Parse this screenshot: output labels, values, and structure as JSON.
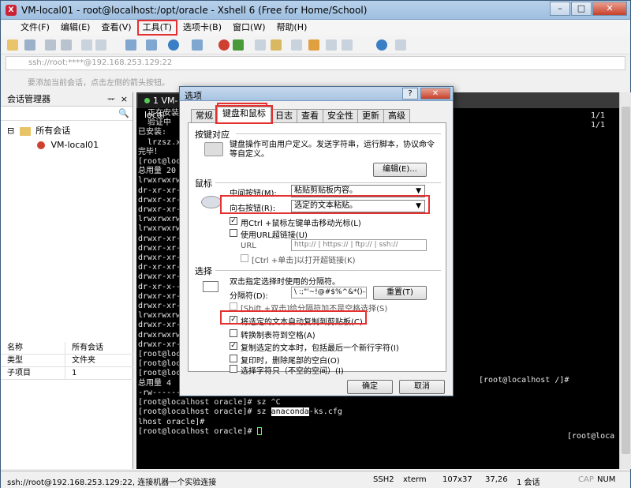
{
  "window": {
    "title": "VM-local01 - root@localhost:/opt/oracle - Xshell 6 (Free for Home/School)",
    "app_icon": "xshell-icon",
    "btn_min": "–",
    "btn_max": "□",
    "btn_close": "✕"
  },
  "menubar": {
    "items": [
      "文件(F)",
      "编辑(E)",
      "查看(V)",
      "工具(T)",
      "选项卡(B)",
      "窗口(W)",
      "帮助(H)"
    ]
  },
  "address": {
    "value": "ssh://root:****@192.168.253.129:22"
  },
  "hint": {
    "text": "要添加当前会话，点击左侧的箭头按钮。"
  },
  "session_manager": {
    "title": "会话管理器",
    "pin": "ᅲ",
    "close": "×",
    "search_icon": "🔍",
    "tree": {
      "root": "所有会话",
      "child": "VM-local01",
      "expander": "⊟"
    },
    "properties": [
      {
        "k": "名称",
        "v": "所有会话"
      },
      {
        "k": "类型",
        "v": "文件夹"
      },
      {
        "k": "子项目",
        "v": "1"
      }
    ]
  },
  "terminal": {
    "tab_label": "1 VM-local",
    "lines": [
      "  正在安装",
      "  验证中",
      "",
      "已安装:",
      "  lrzsz.x",
      "",
      "完毕！",
      "[root@local",
      "总用量 20",
      "lrwxrwxrwx",
      "dr-xr-xr-",
      "drwxr-xr-",
      "drwxr-xr-",
      "lrwxrwxrwx",
      "lrwxrwxrwx",
      "drwxr-xr-",
      "drwxr-xr-",
      "drwxr-xr-",
      "dr-xr-xr-",
      "drwxr-xr-",
      "dr-xr-x---",
      "drwxr-xr-",
      "drwxr-xr-",
      "lrwxrwxrwx",
      "drwxr-xr-",
      "drwxrwxrw",
      "drwxr-xr-",
      "[root@local",
      "[root@local",
      "[root@local",
      "总用量 4",
      "-rw-------. 1 root root 1413 4月   15 20:31 anaconda-ks.cfg",
      "[root@localhost oracle]# sz ^C",
      "[root@localhost oracle]# sz anaconda-ks.cfg",
      "lhost oracle]#",
      "[root@localhost oracle]# "
    ],
    "sel_word": "anaconda",
    "right_1": "1/1",
    "right_2": "1/1",
    "right_prompt": "[root@localhost /]#",
    "right_prompt2": "[root@loca"
  },
  "statusbar": {
    "connection": "ssh://root@192.168.253.129:22, 连接机器一个实验连接",
    "protocol": "SSH2",
    "term": "xterm",
    "size": "107x37",
    "pos": "37,26",
    "sessions": "1 会话",
    "caps": "CAP",
    "num": "NUM"
  },
  "dialog": {
    "title": "选项",
    "help": "?",
    "close": "✕",
    "tabs": [
      "常规",
      "键盘和鼠标",
      "日志",
      "查看",
      "安全性",
      "更新",
      "高级"
    ],
    "keyboard": {
      "section": "按键对应",
      "desc": "键盘操作可由用户定义。发送字符串，运行脚本，协议命令等自定义。",
      "edit_btn": "编辑(E)..."
    },
    "mouse": {
      "section": "鼠标",
      "middle_label": "中间按钮(M):",
      "middle_value": "粘贴剪贴板内容。",
      "right_label": "向右按钮(R):",
      "right_value": "选定的文本粘贴。",
      "ctrl_click": "用Ctrl +鼠标左键单击移动光标(L)",
      "url_hyperlink": "使用URL超链接(U)",
      "url_label": "URL",
      "url_value": "http:// | https:// | ftp:// | ssh://",
      "ctrl_open": "[Ctrl +单击]以打开超链接(K)"
    },
    "selection": {
      "section": "选择",
      "dblclick": "双击指定选择时使用的分隔符。",
      "separator_label": "分隔符(D):",
      "separator_value": "\\ :;\"'~!@#$%^&*()-=+",
      "reset_btn": "重置(T)",
      "shift_click": "[Shift +双击]给分隔符加不是空格选择(S)",
      "auto_copy": "将选定的文本自动复制到剪贴板(C)",
      "convert_tab": "转换制表符到空格(A)",
      "copy_newline": "复制选定的文本时，包括最后一个新行字符(I)",
      "trim_print": "复印时，删除尾部的空白(O)",
      "select_char": "选择字符只（不空的空间）(I)"
    },
    "ok": "确定",
    "cancel": "取消"
  }
}
